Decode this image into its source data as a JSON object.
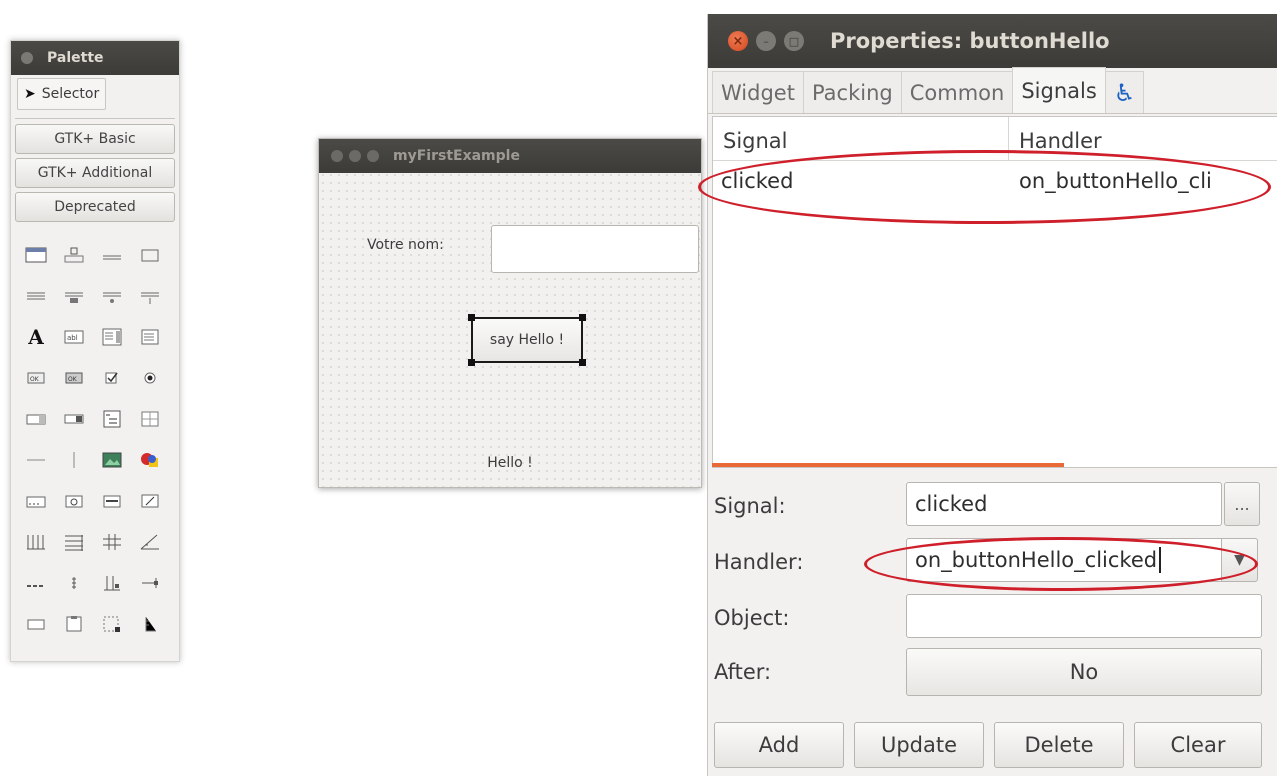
{
  "palette": {
    "title": "Palette",
    "selector_label": "Selector",
    "groups": [
      "GTK+ Basic",
      "GTK+ Additional",
      "Deprecated"
    ],
    "widget_icons": [
      "window-icon",
      "dialog-icon",
      "about-dialog-icon",
      "assistant-icon",
      "file-chooser-icon",
      "color-chooser-icon",
      "font-chooser-icon",
      "recent-chooser-icon",
      "label-icon",
      "entry-icon",
      "text-view-icon",
      "list-icon",
      "button-icon",
      "toggle-button-icon",
      "check-button-icon",
      "radio-button-icon",
      "spin-button-icon",
      "combo-box-icon",
      "tree-view-icon",
      "grid-icon",
      "hseparator-icon",
      "vseparator-icon",
      "image-icon",
      "drawing-area-icon",
      "toolbar-icon",
      "statusbar-icon",
      "menubar-icon",
      "progress-icon",
      "vbox-icon",
      "hbox-icon",
      "table-icon",
      "scale-icon",
      "hpaned-icon",
      "vpaned-icon",
      "notebook-icon",
      "frame-icon",
      "scrolled-window-icon",
      "viewport-icon",
      "layout-icon",
      "ruler-icon"
    ]
  },
  "example": {
    "title": "myFirstExample",
    "name_label": "Votre nom:",
    "button_label": "say Hello !",
    "output_label": "Hello !"
  },
  "props": {
    "title": "Properties: buttonHello",
    "tabs": [
      "Widget",
      "Packing",
      "Common",
      "Signals"
    ],
    "list_headers": [
      "Signal",
      "Handler"
    ],
    "rows": [
      {
        "signal": "clicked",
        "handler": "on_buttonHello_cli"
      }
    ],
    "form": {
      "signal_label": "Signal:",
      "signal_value": "clicked",
      "dots_label": "...",
      "handler_label": "Handler:",
      "handler_value": "on_buttonHello_clicked",
      "object_label": "Object:",
      "object_value": "",
      "after_label": "After:",
      "after_value": "No"
    },
    "actions": [
      "Add",
      "Update",
      "Delete",
      "Clear"
    ],
    "accent_color": "#e96a37",
    "annotation_color": "#cf1f2a"
  }
}
